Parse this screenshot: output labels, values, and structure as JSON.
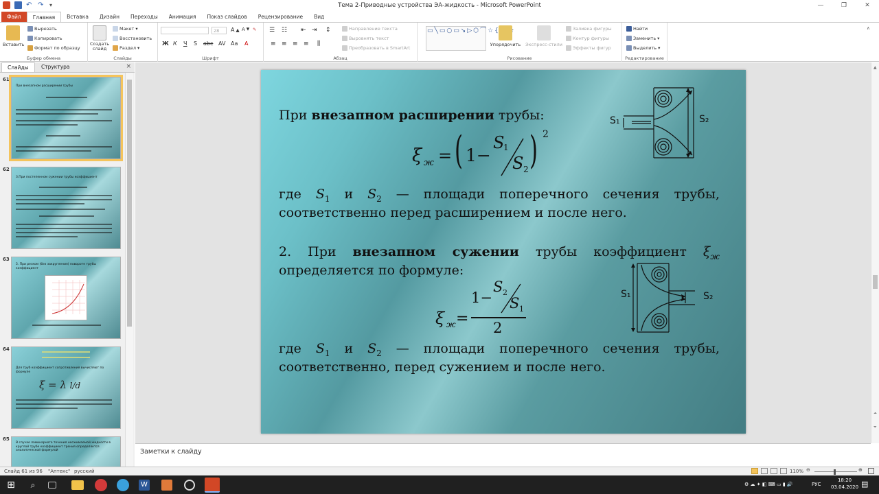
{
  "window": {
    "title": "Тема 2-Приводные устройства ЭА-жидкость  -  Microsoft PowerPoint"
  },
  "ribbon_tabs": [
    "Файл",
    "Главная",
    "Вставка",
    "Дизайн",
    "Переходы",
    "Анимация",
    "Показ слайдов",
    "Рецензирование",
    "Вид"
  ],
  "ribbon": {
    "clipboard": {
      "paste": "Вставить",
      "cut": "Вырезать",
      "copy": "Копировать",
      "format_painter": "Формат по образцу",
      "group": "Буфер обмена"
    },
    "slides": {
      "new_slide": "Создать слайд",
      "layout": "Макет",
      "reset": "Восстановить",
      "section": "Раздел",
      "group": "Слайды"
    },
    "font": {
      "font_size": "28",
      "group": "Шрифт"
    },
    "paragraph": {
      "text_direction": "Направление текста",
      "align_text": "Выровнять текст",
      "smartart": "Преобразовать в SmartArt",
      "group": "Абзац"
    },
    "drawing": {
      "arrange": "Упорядочить",
      "quick_styles": "Экспресс-стили",
      "shape_fill": "Заливка фигуры",
      "shape_outline": "Контур фигуры",
      "shape_effects": "Эффекты фигур",
      "group": "Рисование"
    },
    "editing": {
      "find": "Найти",
      "replace": "Заменить",
      "select": "Выделить",
      "group": "Редактирование"
    }
  },
  "panel": {
    "tab_slides": "Слайды",
    "tab_outline": "Структура",
    "close": "×",
    "thumbnails": [
      {
        "num": "61",
        "text": "При внезапном расширении трубы"
      },
      {
        "num": "62",
        "text": "3.При постепенном сужении трубы коэффициент"
      },
      {
        "num": "63",
        "text": "5. При резком (без закругления) повороте трубы коэффициент"
      },
      {
        "num": "64",
        "text": "Для труб коэффициент сопротивления вычисляют по формуле"
      },
      {
        "num": "65",
        "text": "В случае ламинарного течения несжимаемой жидкости в круглой трубе коэффициент трения определяется аналитической формулой"
      }
    ]
  },
  "slide": {
    "line1_prefix": "При ",
    "line1_bold": "внезапном расширении",
    "line1_suffix": " трубы:",
    "formula1": {
      "lhs": "ξ",
      "lhs_sub": "ж",
      "eq": "=",
      "one_minus": "1−",
      "num": "S",
      "num_sub": "1",
      "den": "S",
      "den_sub": "2",
      "power": "2"
    },
    "where1_a": "где",
    "where1_s1": "S",
    "where1_s1_sub": "1",
    "where1_and": "и",
    "where1_s2": "S",
    "where1_s2_sub": "2",
    "where1_rest": "— площади поперечного сечения трубы,",
    "where1_line2": "соответственно перед расширением и после него.",
    "line2_num": "2.",
    "line2_prefix": "При",
    "line2_bold": "внезапном сужении",
    "line2_suffix": "трубы коэффициент",
    "line2_xi": "ξ",
    "line2_xi_sub": "ж",
    "line2_line2": "определяется по формуле:",
    "formula2": {
      "lhs": "ξ",
      "lhs_sub": "ж",
      "eq": "=",
      "one_minus": "1−",
      "num": "S",
      "num_sub": "2",
      "den": "S",
      "den_sub": "1",
      "denom": "2"
    },
    "where2_a": "где",
    "where2_s1": "S",
    "where2_s1_sub": "1",
    "where2_and": "и",
    "where2_s2": "S",
    "where2_s2_sub": "2",
    "where2_rest": "— площади поперечного сечения трубы,",
    "where2_line2": "соответственно, перед сужением и после него.",
    "diagram1": {
      "s1": "S₁",
      "s2": "S₂"
    },
    "diagram2": {
      "s1": "S₁",
      "s2": "S₂"
    }
  },
  "notes": {
    "placeholder": "Заметки к слайду"
  },
  "statusbar": {
    "slide_info": "Слайд 61 из 96",
    "theme": "\"Аптекс\"",
    "language": "русский",
    "zoom": "110%"
  },
  "taskbar": {
    "lang": "РУС",
    "time": "18:20",
    "date": "03.04.2020"
  },
  "colors": {
    "file_tab": "#d24726",
    "selected_thumb": "#f4c45c",
    "taskbar": "#202020"
  }
}
